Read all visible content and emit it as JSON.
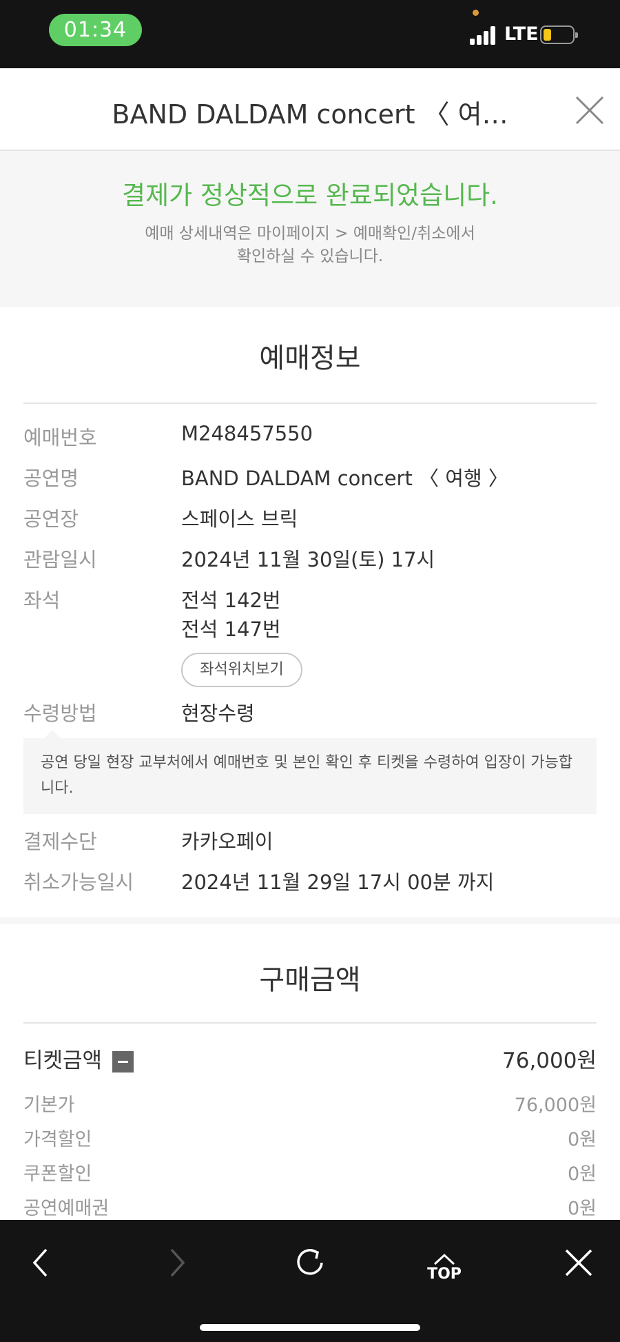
{
  "status_bar": {
    "time": "01:34",
    "network": "LTE"
  },
  "header": {
    "title": "BAND DALDAM concert 〈 여…"
  },
  "notice": {
    "main": "결제가 정상적으로 완료되었습니다.",
    "sub_line1": "예매 상세내역은 마이페이지 > 예매확인/취소에서",
    "sub_line2": "확인하실 수 있습니다."
  },
  "booking": {
    "title": "예매정보",
    "rows": [
      {
        "label": "예매번호",
        "value": "M248457550"
      },
      {
        "label": "공연명",
        "value": "BAND DALDAM concert 〈 여행 〉"
      },
      {
        "label": "공연장",
        "value": "스페이스 브릭"
      },
      {
        "label": "관람일시",
        "value": "2024년 11월 30일(토) 17시"
      }
    ],
    "seat": {
      "label": "좌석",
      "seats": [
        "전석 142번",
        "전석 147번"
      ],
      "button": "좌석위치보기"
    },
    "pickup": {
      "label": "수령방법",
      "value": "현장수령",
      "info": "공연 당일 현장 교부처에서 예매번호 및 본인 확인 후 티켓을 수령하여 입장이 가능합니다."
    },
    "payment": {
      "label": "결제수단",
      "value": "카카오페이"
    },
    "cancel": {
      "label": "취소가능일시",
      "value": "2024년 11월 29일 17시 00분 까지"
    }
  },
  "purchase": {
    "title": "구매금액",
    "ticket": {
      "label": "티켓금액",
      "value": "76,000원"
    },
    "items": [
      {
        "label": "기본가",
        "value": "76,000원"
      },
      {
        "label": "가격할인",
        "value": "0원"
      },
      {
        "label": "쿠폰할인",
        "value": "0원"
      },
      {
        "label": "공연예매권",
        "value": "0원"
      }
    ]
  },
  "toolbar": {
    "top_label": "TOP"
  },
  "colors": {
    "accent_green": "#56b84f",
    "clock_pill": "#5fcf65",
    "bar_dark": "#141414"
  }
}
